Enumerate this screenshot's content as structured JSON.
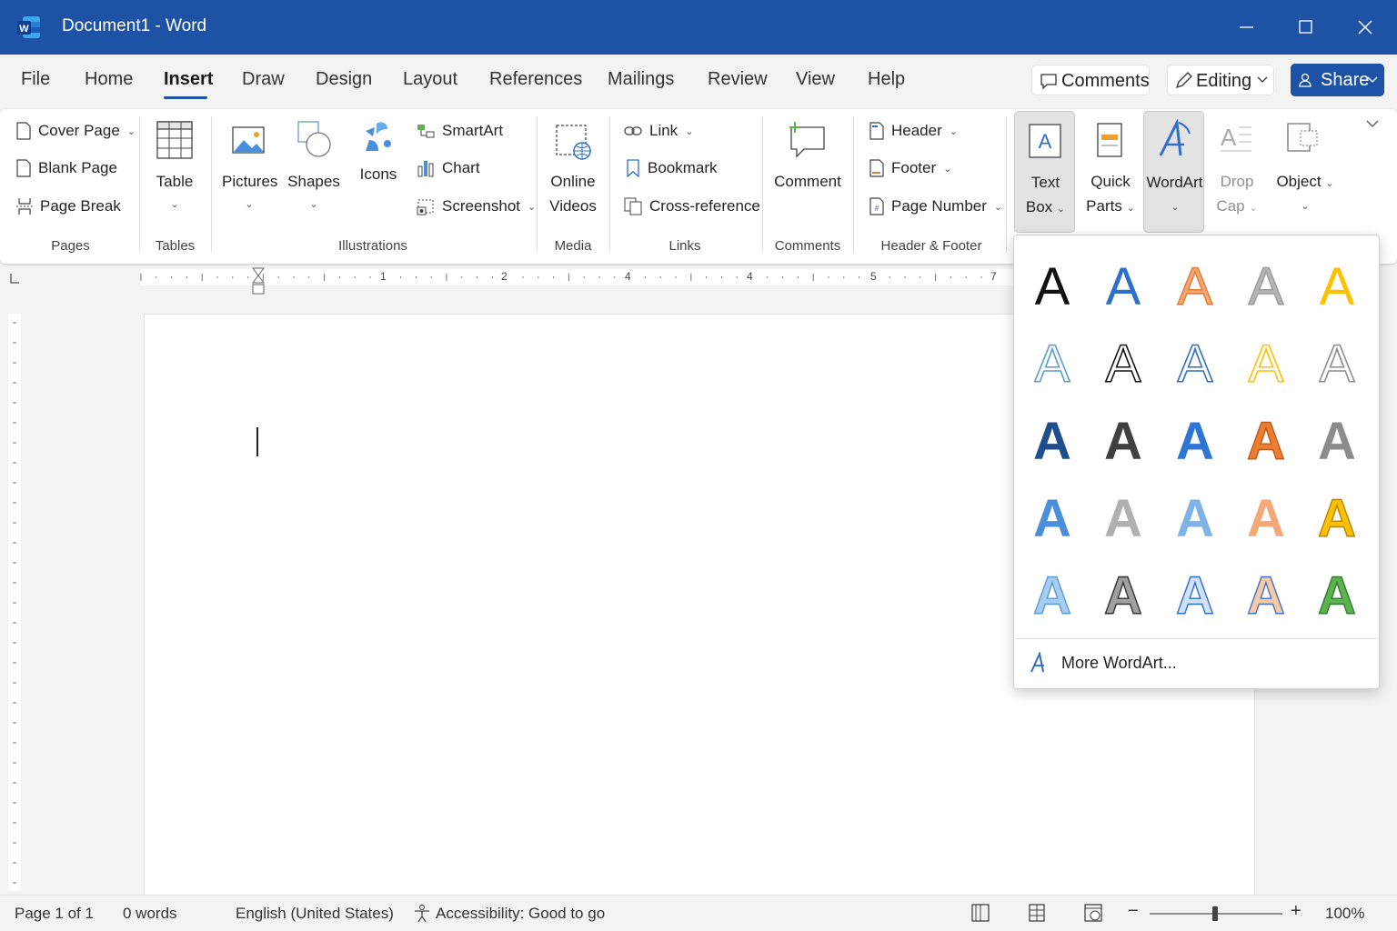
{
  "window": {
    "title": "Document1  -  Word"
  },
  "tabs": [
    "File",
    "Home",
    "Insert",
    "Draw",
    "Design",
    "Layout",
    "References",
    "Mailings",
    "Review",
    "View",
    "Help"
  ],
  "active_tab": "Insert",
  "header_buttons": {
    "comments": "Comments",
    "editing": "Editing",
    "share": "Share"
  },
  "ribbon": {
    "pages": {
      "cover_page": "Cover Page",
      "blank_page": "Blank Page",
      "page_break": "Page Break",
      "group": "Pages"
    },
    "tables": {
      "table": "Table",
      "group": "Tables"
    },
    "illustrations": {
      "pictures": "Pictures",
      "shapes": "Shapes",
      "icons": "Icons",
      "smartart": "SmartArt",
      "chart": "Chart",
      "screenshot": "Screenshot",
      "group": "Illustrations"
    },
    "media": {
      "online": "Online",
      "videos": "Videos",
      "group": "Media"
    },
    "links": {
      "link": "Link",
      "bookmark": "Bookmark",
      "cross_reference": "Cross-reference",
      "group": "Links"
    },
    "comments": {
      "comment": "Comment",
      "group": "Comments"
    },
    "header_footer": {
      "header": "Header",
      "footer": "Footer",
      "page_number": "Page Number",
      "group": "Header & Footer"
    },
    "text": {
      "text": "Text",
      "box": "Box",
      "quick": "Quick",
      "parts": "Parts",
      "wordart": "WordArt",
      "drop": "Drop",
      "cap": "Cap",
      "object": "Object"
    }
  },
  "ruler": {
    "labels": [
      "1",
      "2",
      "4",
      "4",
      "5",
      "7"
    ]
  },
  "wordart_gallery": {
    "glyph": "A",
    "more_label": "More WordArt...",
    "styles": [
      {
        "fill": "#111111",
        "stroke": "none"
      },
      {
        "fill": "#2e6fcc",
        "stroke": "none"
      },
      {
        "fill": "#f7a66f",
        "stroke": "#e07b39"
      },
      {
        "fill": "#b5b5b5",
        "stroke": "#9a9a9a"
      },
      {
        "fill": "#ffc000",
        "stroke": "none"
      },
      {
        "fill": "#ffffff",
        "stroke": "#5b9bd5"
      },
      {
        "fill": "#ffffff",
        "stroke": "#111111"
      },
      {
        "fill": "#ffffff",
        "stroke": "#2e6fcc"
      },
      {
        "fill": "#ffffff",
        "stroke": "#ffc000"
      },
      {
        "fill": "#ffffff",
        "stroke": "#8c8c8c"
      },
      {
        "fill": "#1f4e8c",
        "stroke": "none"
      },
      {
        "fill": "#404040",
        "stroke": "none"
      },
      {
        "fill": "#2e75d6",
        "stroke": "none"
      },
      {
        "fill": "#ed7d31",
        "stroke": "#c05a1a"
      },
      {
        "fill": "#8c8c8c",
        "stroke": "none"
      },
      {
        "fill": "#4a8fdc",
        "stroke": "none"
      },
      {
        "fill": "#b0b0b0",
        "stroke": "none"
      },
      {
        "fill": "#7fb3e8",
        "stroke": "none"
      },
      {
        "fill": "#f4a877",
        "stroke": "none"
      },
      {
        "fill": "#ffc000",
        "stroke": "#b38600"
      },
      {
        "fill": "#a7cdf0",
        "stroke": "#5b9bd5"
      },
      {
        "fill": "#a0a0a0",
        "stroke": "#333333"
      },
      {
        "fill": "#cfe2f7",
        "stroke": "#2e6fcc"
      },
      {
        "fill": "#f8c9a5",
        "stroke": "#4472c4"
      },
      {
        "fill": "#5fb04f",
        "stroke": "#2e7d32"
      }
    ]
  },
  "status": {
    "page": "Page 1 of 1",
    "words": "0 words",
    "language": "English (United States)",
    "accessibility": "Accessibility: Good to go",
    "zoom": "100%"
  }
}
